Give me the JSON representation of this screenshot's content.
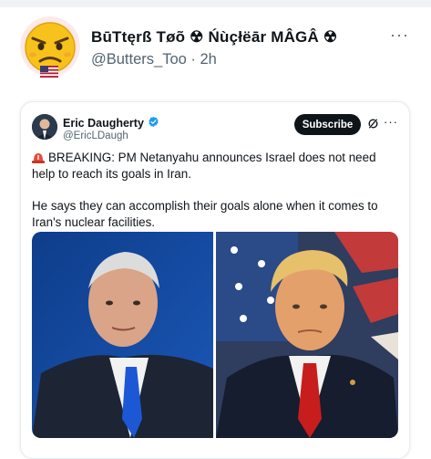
{
  "post": {
    "display_name": "BūTtęrß Tøõ ☢ Ńùçłëār MÂGÂ ☢",
    "handle": "@Butters_Too",
    "separator": "·",
    "time": "2h",
    "more_label": "···"
  },
  "quoted": {
    "author_name": "Eric Daugherty",
    "author_handle": "@EricLDaugh",
    "subscribe_label": "Subscribe",
    "more_label": "···",
    "paragraph1": "BREAKING: PM Netanyahu announces Israel does not need help to reach its goals in Iran.",
    "paragraph2": "He says they can accomplish their goals alone when it comes to Iran's nuclear facilities."
  },
  "colors": {
    "verified": "#1d9bf0",
    "subscribe_bg": "#0f1419",
    "muted": "#536471"
  },
  "icons": [
    "angry-emoji-avatar",
    "us-flag-icon",
    "verified-badge-icon",
    "grok-icon",
    "siren-icon"
  ]
}
